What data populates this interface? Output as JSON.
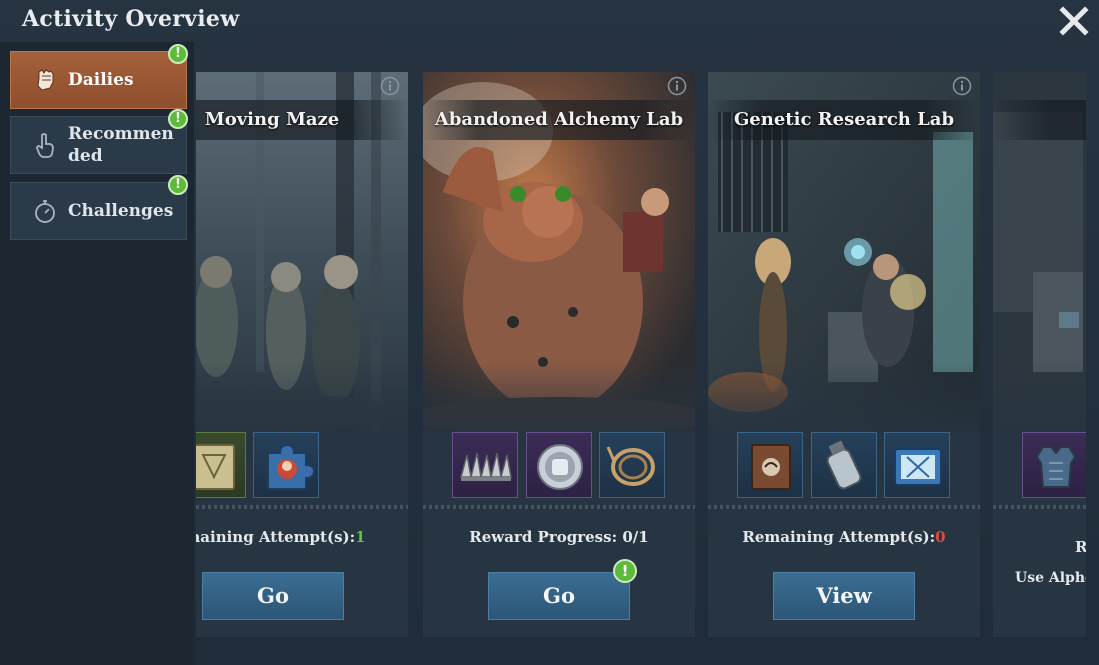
{
  "window": {
    "title": "Activity Overview"
  },
  "sidebar": {
    "items": [
      {
        "label": "Dailies",
        "active": true,
        "badge": "!"
      },
      {
        "label": "Recommended",
        "active": false,
        "badge": "!"
      },
      {
        "label": "Challenges",
        "active": false,
        "badge": "!"
      }
    ]
  },
  "cards": [
    {
      "name": "Moving Maze",
      "status_text": "Remaining Attempt(s):",
      "status_value": "1",
      "button_label": "Go"
    },
    {
      "name": "Abandoned Alchemy Lab",
      "status_text": "Reward Progress: 0/1",
      "button_label": "Go",
      "button_badge": "!"
    },
    {
      "name": "Genetic Research Lab",
      "status_text": "Remaining Attempt(s):",
      "status_value": "0",
      "button_label": "View"
    },
    {
      "name": "",
      "status_text": "R",
      "status_text_2": "Use Alpho"
    }
  ],
  "colors": {
    "accent_active": "#a5603a",
    "button_blue": "#3b6d92",
    "value_green": "#5ec23c",
    "value_red": "#e24b3b",
    "badge_green": "#5dbb3a"
  }
}
